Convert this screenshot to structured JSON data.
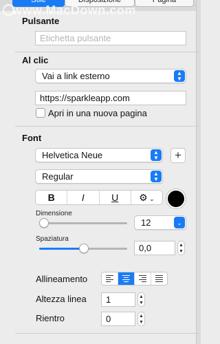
{
  "tabs": [
    {
      "label": "Stile",
      "active": true
    },
    {
      "label": "Disposizione",
      "active": false
    },
    {
      "label": "Pagina",
      "active": false
    }
  ],
  "watermark": "www.MacDown.com",
  "pulsante": {
    "heading": "Pulsante",
    "label_placeholder": "Etichetta pulsante"
  },
  "al_clic": {
    "heading": "Al clic",
    "action_selected": "Vai a link esterno",
    "url_value": "https://sparkleapp.com",
    "new_page_label": "Apri in una nuova pagina",
    "new_page_checked": false
  },
  "font": {
    "heading": "Font",
    "family": "Helvetica Neue",
    "weight": "Regular",
    "style_buttons": [
      "B",
      "I",
      "U"
    ],
    "gear_menu_icon": "gear-icon",
    "color": "#000000",
    "size_label": "Dimensione",
    "size_value": "12",
    "size_slider_fraction": 0.05,
    "spacing_label": "Spaziatura",
    "spacing_value": "0,0",
    "spacing_slider_fraction": 0.5
  },
  "paragraph": {
    "alignment_label": "Allineamento",
    "alignment_options": [
      "left",
      "center",
      "right",
      "justify"
    ],
    "alignment_selected": "center",
    "line_height_label": "Altezza linea",
    "line_height_value": "1",
    "indent_label": "Rientro",
    "indent_value": "0"
  },
  "colors": {
    "accent": "#1a7cf5"
  }
}
